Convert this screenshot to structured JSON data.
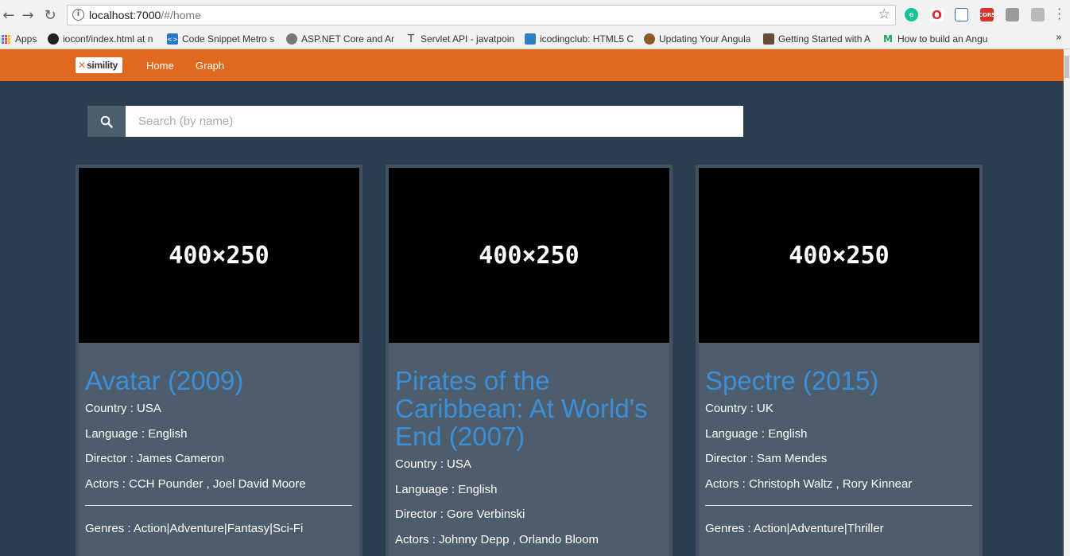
{
  "browser": {
    "url_host": "localhost:7000",
    "url_path": "/#/home",
    "bookmarks": [
      {
        "label": "Apps"
      },
      {
        "label": "ioconf/index.html at n"
      },
      {
        "label": "Code Snippet Metro s"
      },
      {
        "label": "ASP.NET Core and An"
      },
      {
        "label": "Servlet API - javatpoin"
      },
      {
        "label": "icodingclub: HTML5 C"
      },
      {
        "label": "Updating Your Angula"
      },
      {
        "label": "Getting Started with A"
      },
      {
        "label": "How to build an Angu"
      }
    ],
    "more_bookmarks": "»",
    "extension_cors_label": "CORS"
  },
  "navbar": {
    "logo_text": "simility",
    "links": [
      {
        "label": "Home"
      },
      {
        "label": "Graph"
      }
    ]
  },
  "search": {
    "placeholder": "Search (by name)",
    "value": ""
  },
  "movies": [
    {
      "image_label": "400×250",
      "title": "Avatar (2009)",
      "country": "Country : USA",
      "language": "Language : English",
      "director": "Director : James Cameron",
      "actors": "Actors : CCH Pounder , Joel David Moore",
      "genres": "Genres : Action|Adventure|Fantasy|Sci-Fi"
    },
    {
      "image_label": "400×250",
      "title": "Pirates of the Caribbean: At World's End (2007)",
      "country": "Country : USA",
      "language": "Language : English",
      "director": "Director : Gore Verbinski",
      "actors": "Actors : Johnny Depp , Orlando Bloom",
      "genres": ""
    },
    {
      "image_label": "400×250",
      "title": "Spectre (2015)",
      "country": "Country : UK",
      "language": "Language : English",
      "director": "Director : Sam Mendes",
      "actors": "Actors : Christoph Waltz , Rory Kinnear",
      "genres": "Genres : Action|Adventure|Thriller"
    }
  ],
  "colors": {
    "navbar": "#e0691d",
    "page_background": "#2c3e50",
    "card_background": "#4e5d6c",
    "title_link": "#3a8fd8"
  }
}
